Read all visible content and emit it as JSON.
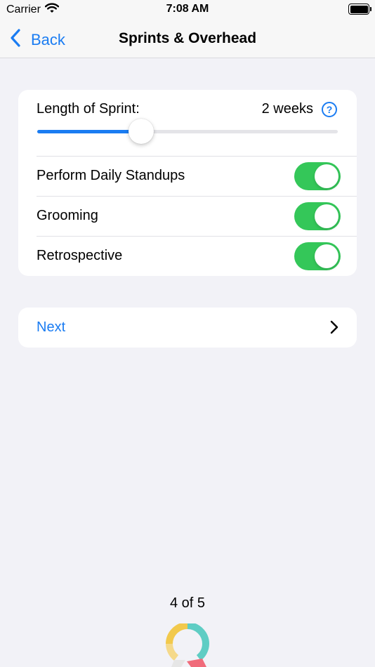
{
  "status_bar": {
    "carrier": "Carrier",
    "time": "7:08 AM",
    "icons": [
      "wifi-icon",
      "battery-icon"
    ]
  },
  "nav": {
    "back_label": "Back",
    "title": "Sprints & Overhead",
    "icons": [
      "chevron-left-icon"
    ]
  },
  "sprint": {
    "label": "Length of Sprint:",
    "value": "2 weeks",
    "help_icon": "question-circle-icon",
    "slider_fraction": 0.345
  },
  "toggles": [
    {
      "label": "Perform Daily Standups",
      "on": true
    },
    {
      "label": "Grooming",
      "on": true
    },
    {
      "label": "Retrospective",
      "on": true
    }
  ],
  "next": {
    "label": "Next",
    "icon": "chevron-right-icon"
  },
  "page_indicator": "4 of 5",
  "colors": {
    "accent": "#1a7cf2",
    "switch_on": "#34c759",
    "background": "#f2f2f7",
    "card": "#ffffff"
  }
}
